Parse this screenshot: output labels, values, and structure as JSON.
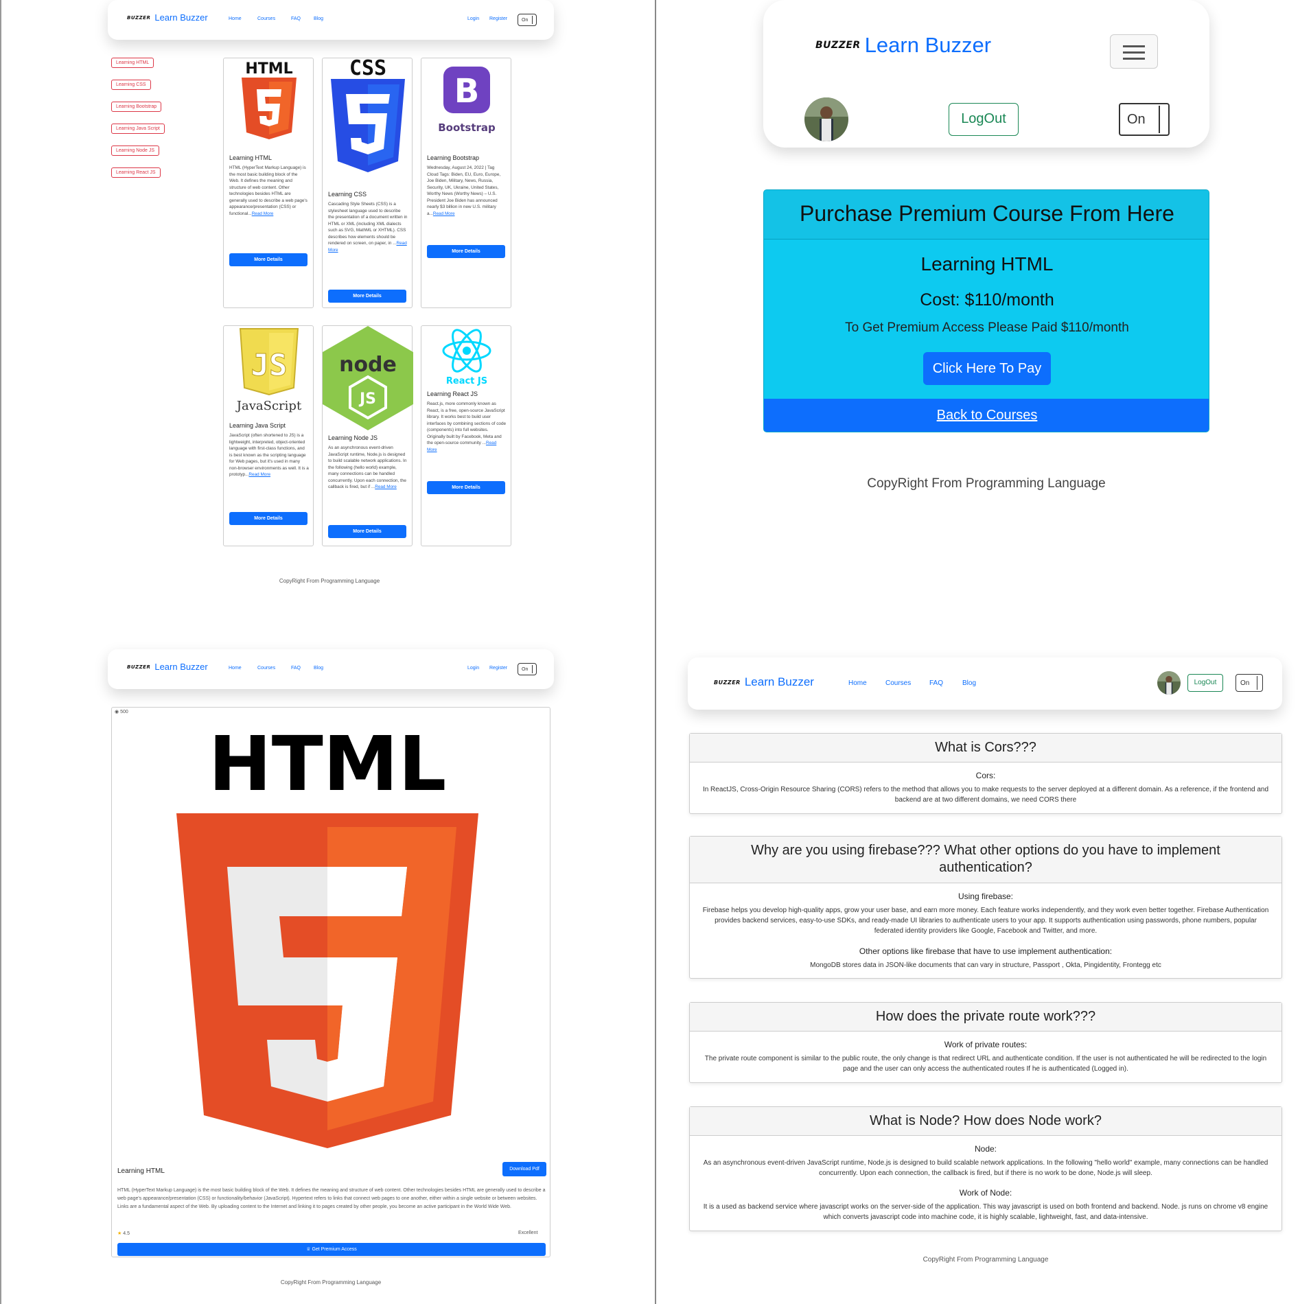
{
  "brand": {
    "mark": "BUZZER",
    "name": "Learn Buzzer"
  },
  "nav": {
    "home": "Home",
    "courses": "Courses",
    "faq": "FAQ",
    "blog": "Blog",
    "login": "Login",
    "register": "Register",
    "toggle": "On",
    "logout": "LogOut"
  },
  "sidebar": {
    "items": [
      "Learning HTML",
      "Learning CSS",
      "Learning Bootstrap",
      "Learning Java Script",
      "Learning Node JS",
      "Learning React JS"
    ]
  },
  "courses": [
    {
      "logo": "HTML",
      "title": "Learning HTML",
      "body": "HTML (HyperText Markup Language) is the most basic building block of the Web. It defines the meaning and structure of web content. Other technologies besides HTML are generally used to describe a web page's appearance/presentation (CSS) or functional...",
      "more": "Read More",
      "button": "More Details"
    },
    {
      "logo": "CSS",
      "title": "Learning CSS",
      "body": "Cascading Style Sheets (CSS) is a stylesheet language used to describe the presentation of a document written in HTML or XML (including XML dialects such as SVG, MathML or XHTML). CSS describes how elements should be rendered on screen, on paper, in ...",
      "more": "Read More",
      "button": "More Details"
    },
    {
      "logo": "Bootstrap",
      "title": "Learning Bootstrap",
      "body": "Wednesday, August 24, 2022 | Tag Cloud Tags: Biden, EU, Euro, Europe, Joe Biden, Military, News, Russia, Security, UK, Ukraine, United States, Worthy News (Worthy News) – U.S. President Joe Biden has announced nearly $3 billion in new U.S. military a...",
      "more": "Read More",
      "button": "More Details"
    },
    {
      "logo": "JavaScript",
      "title": "Learning Java Script",
      "body": "JavaScript (often shortened to JS) is a lightweight, interpreted, object-oriented language with first-class functions, and is best known as the scripting language for Web pages, but it's used in many non-browser environments as well. It is a prototyp...",
      "more": "Read More",
      "button": "More Details"
    },
    {
      "logo": "node JS",
      "title": "Learning Node JS",
      "body": "As an asynchronous event-driven JavaScript runtime, Node.js is designed to build scalable network applications. In the following (hello world) example, many connections can be handled concurrently. Upon each connection, the callback is fired, but if ...",
      "more": "Read More",
      "button": "More Details"
    },
    {
      "logo": "React JS",
      "title": "Learning React JS",
      "body": "React.js, more commonly known as React, is a free, open-source JavaScript library. It works best to build user interfaces by combining sections of code (components) into full websites. Originally built by Facebook, Meta and the open-source community ...",
      "more": "Read More",
      "button": "More Details"
    }
  ],
  "footer": "CopyRight From Programming Language",
  "premium": {
    "header": "Purchase Premium Course From Here",
    "course": "Learning HTML",
    "cost": "Cost: $110/month",
    "note": "To Get Premium Access Please Paid $110/month",
    "pay": "Click Here To Pay",
    "back": "Back to Courses"
  },
  "detail": {
    "views": "500",
    "logo": "HTML",
    "title": "Learning HTML",
    "download": "Download Pdf",
    "body": "HTML (HyperText Markup Language) is the most basic building block of the Web. It defines the meaning and structure of web content. Other technologies besides HTML are generally used to describe a web page's appearance/presentation (CSS) or functionality/behavior (JavaScript). Hypertext refers to links that connect web pages to one another, either within a single website or between websites. Links are a fundamental aspect of the Web. By uploading content to the Internet and linking it to pages created by other people, you become an active participant in the World Wide Web.",
    "rating": "4.5",
    "rating_label": "Excellent",
    "premium": "Get Premium Access"
  },
  "faq": [
    {
      "q": "What is Cors???",
      "parts": [
        {
          "h": "Cors:",
          "t": "In ReactJS, Cross-Origin Resource Sharing (CORS) refers to the method that allows you to make requests to the server deployed at a different domain. As a reference, if the frontend and backend are at two different domains, we need CORS there"
        }
      ]
    },
    {
      "q": "Why are you using firebase??? What other options do you have to implement authentication?",
      "parts": [
        {
          "h": "Using firebase:",
          "t": "Firebase helps you develop high-quality apps, grow your user base, and earn more money. Each feature works independently, and they work even better together. Firebase Authentication provides backend services, easy-to-use SDKs, and ready-made UI libraries to authenticate users to your app. It supports authentication using passwords, phone numbers, popular federated identity providers like Google, Facebook and Twitter, and more."
        },
        {
          "h": "Other options like firebase that have to use implement authentication:",
          "t": "MongoDB stores data in JSON-like documents that can vary in structure, Passport , Okta, Pingidentity, Frontegg etc"
        }
      ]
    },
    {
      "q": "How does the private route work???",
      "parts": [
        {
          "h": "Work of private routes:",
          "t": "The private route component is similar to the public route, the only change is that redirect URL and authenticate condition. If the user is not authenticated he will be redirected to the login page and the user can only access the authenticated routes If he is authenticated (Logged in)."
        }
      ]
    },
    {
      "q": "What is Node? How does Node work?",
      "parts": [
        {
          "h": "Node:",
          "t": "As an asynchronous event-driven JavaScript runtime, Node.js is designed to build scalable network applications. In the following \"hello world\" example, many connections can be handled concurrently. Upon each connection, the callback is fired, but if there is no work to be done, Node.js will sleep."
        },
        {
          "h": "Work of Node:",
          "t": "It is a used as backend service where javascript works on the server-side of the application. This way javascript is used on both frontend and backend. Node. js runs on chrome v8 engine which converts javascript code into machine code, it is highly scalable, lightweight, fast, and data-intensive."
        }
      ]
    }
  ],
  "colors": {
    "primary": "#0d6efd",
    "info": "#0dcaf0",
    "danger": "#dc3545",
    "success": "#198754",
    "html_orange": "#e44d26",
    "css_blue": "#264de4",
    "bootstrap_purple": "#6f42c1",
    "js_yellow": "#f0db4f",
    "node_green": "#8cc84b",
    "react_cyan": "#61dafb"
  }
}
